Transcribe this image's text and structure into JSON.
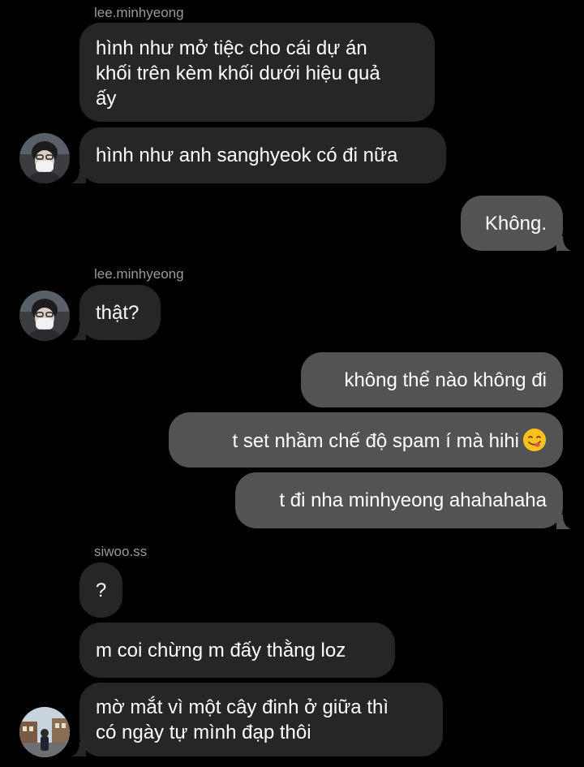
{
  "thread": {
    "groups": [
      {
        "sender": "lee.minhyeong",
        "messages": [
          {
            "lines": [
              "hình như mở tiệc cho cái dự án",
              "khối trên kèm khối dưới hiệu quả",
              "ấy"
            ]
          },
          {
            "text": "hình như anh sanghyeok có đi nữa"
          }
        ]
      },
      {
        "sender": "me",
        "messages": [
          {
            "text": "Không."
          }
        ]
      },
      {
        "sender": "lee.minhyeong",
        "messages": [
          {
            "text": "thật?"
          }
        ]
      },
      {
        "sender": "me",
        "messages": [
          {
            "text": "không thể nào không đi"
          },
          {
            "text": "t set nhầm chế độ spam í mà hihi",
            "emoji": "yum-face-emoji"
          },
          {
            "text": "t đi nha minhyeong ahahahaha"
          }
        ]
      },
      {
        "sender": "siwoo.ss",
        "messages": [
          {
            "text": "?"
          },
          {
            "text": "m coi chừng m đấy thằng loz"
          },
          {
            "lines": [
              "mờ mắt vì một cây đinh ở giữa thì",
              "có ngày tự mình đạp thôi"
            ]
          }
        ]
      }
    ]
  },
  "colors": {
    "background": "#000000",
    "incoming_bubble": "#262626",
    "outgoing_bubble": "#535353",
    "sender_label": "#9a9a9a",
    "text": "#ffffff"
  }
}
